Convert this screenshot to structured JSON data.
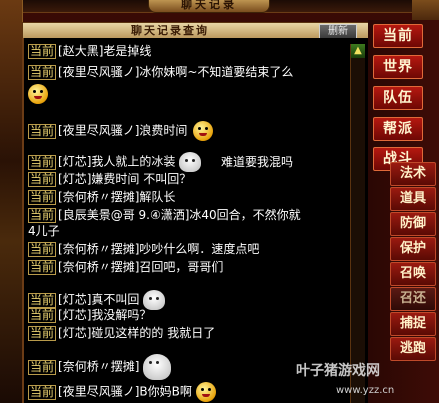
{
  "window": {
    "title": "聊天记录",
    "header_title": "聊天记录查询",
    "clear_label": "删新",
    "close_label": "✕"
  },
  "chat": {
    "lines": [
      {
        "tag": "当前",
        "text": "[赵大黑]老是掉线",
        "emoji": null
      },
      {
        "tag": "当前",
        "text": "[夜里尽风骚ノ]冰你妹啊~不知道要结束了么",
        "emoji": "yellow-face"
      },
      {
        "tag": "当前",
        "text": "[夜里尽风骚ノ]浪费时间",
        "emoji": "yellow-face"
      },
      {
        "tag": "当前",
        "text": "[灯芯]我人就上的冰装",
        "emoji": "ghost",
        "after": "难道要我混吗"
      },
      {
        "tag": "当前",
        "text": "[灯芯]嫌费时间 不叫回？",
        "emoji": null
      },
      {
        "tag": "当前",
        "text": "[奈何桥〃摆摊]解队长",
        "emoji": null
      },
      {
        "tag": "当前",
        "text": "[良辰美景@哥 9.④潇洒]冰40回合，不然你就",
        "emoji": null
      },
      {
        "tag": "",
        "text": "4儿子",
        "emoji": null
      },
      {
        "tag": "当前",
        "text": "[奈何桥〃摆摊]吵吵什么啊．速度点吧",
        "emoji": null
      },
      {
        "tag": "当前",
        "text": "[奈何桥〃摆摊]召回吧，哥哥们",
        "emoji": null
      },
      {
        "tag": "当前",
        "text": "[灯芯]真不叫回",
        "emoji": "ghost"
      },
      {
        "tag": "当前",
        "text": "[灯芯]我没解吗？",
        "emoji": null
      },
      {
        "tag": "当前",
        "text": "[灯芯]碰见这样的的 我就日了",
        "emoji": null
      },
      {
        "tag": "当前",
        "text": "[奈何桥〃摆摊]",
        "emoji": "ghost-big"
      },
      {
        "tag": "当前",
        "text": "[夜里尽风骚ノ]B你妈B啊",
        "emoji": "yellow-face"
      }
    ]
  },
  "sidebar": {
    "primary": [
      "当前",
      "世界",
      "队伍",
      "帮派",
      "战斗"
    ],
    "secondary": [
      "法术",
      "道具",
      "防御",
      "保护",
      "召唤",
      "召还",
      "捕捉",
      "逃跑"
    ]
  },
  "watermark": {
    "text": "叶子猪游戏网",
    "url": "www.yzz.cn"
  },
  "icons": {
    "close": "close-icon",
    "scroll_up": "scroll-up-icon",
    "emoji_yellow": "yellow-face-emoji",
    "emoji_ghost": "ghost-emoji"
  }
}
